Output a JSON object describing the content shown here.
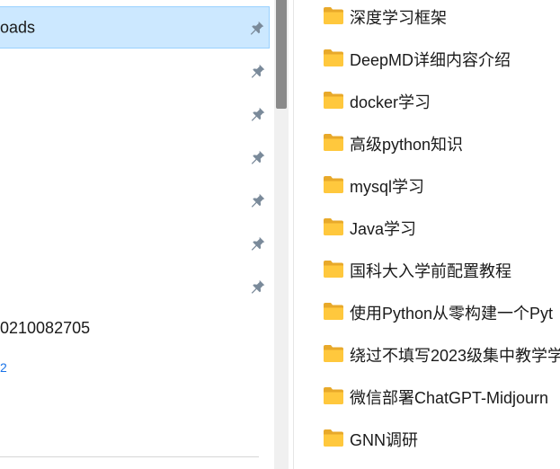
{
  "nav": {
    "selected_item_label": "oads",
    "pinned_count": 7,
    "partial_text": "0210082705",
    "partial_link": "2"
  },
  "files": [
    {
      "name": "深度学习框架"
    },
    {
      "name": "DeepMD详细内容介绍"
    },
    {
      "name": "docker学习"
    },
    {
      "name": "高级python知识"
    },
    {
      "name": "mysql学习"
    },
    {
      "name": "Java学习"
    },
    {
      "name": "国科大入学前配置教程"
    },
    {
      "name": "使用Python从零构建一个Pyt"
    },
    {
      "name": "绕过不填写2023级集中教学学"
    },
    {
      "name": "微信部署ChatGPT-Midjourn"
    },
    {
      "name": "GNN调研"
    }
  ],
  "colors": {
    "selection_bg": "#cce8ff",
    "selection_border": "#99d1ff",
    "folder_yellow": "#ffc83d",
    "pin_gray": "#7a8a9a",
    "scroll_thumb": "#8a8a8a"
  },
  "icons": {
    "pin": "pin-icon",
    "folder": "folder-icon"
  }
}
